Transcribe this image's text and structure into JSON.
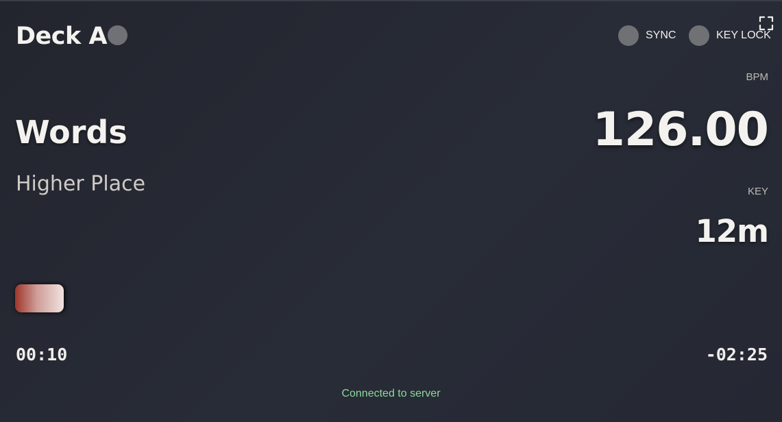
{
  "deck": {
    "title": "Deck A"
  },
  "toggles": {
    "sync_label": "SYNC",
    "keylock_label": "KEY LOCK"
  },
  "icons": {
    "fullscreen": "fullscreen-icon"
  },
  "track": {
    "title": "Words",
    "artist": "Higher Place"
  },
  "tempo": {
    "bpm_label": "BPM",
    "bpm_value": "126.00",
    "key_label": "KEY",
    "key_value": "12m"
  },
  "playback": {
    "progress_fraction": 0.065,
    "elapsed": "00:10",
    "remaining": "-02:25"
  },
  "status": {
    "text": "Connected to server"
  },
  "colors": {
    "background": "#262933",
    "indicator_off": "#6f7175",
    "progress_start": "#a0362c",
    "progress_end": "#f0e3e0",
    "status_connected": "#8fd99a"
  }
}
